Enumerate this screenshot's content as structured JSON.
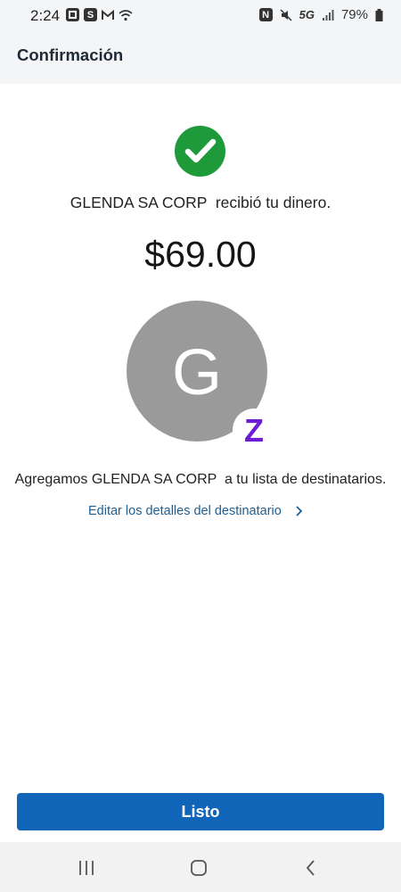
{
  "status_bar": {
    "time": "2:24",
    "network": "5G",
    "battery": "79%",
    "icons_left": [
      "chase-icon",
      "s-app-icon",
      "gmail-icon",
      "wifi-icon"
    ],
    "icons_right": [
      "nfc-icon",
      "mute-icon",
      "signal-icon",
      "battery-icon"
    ]
  },
  "header": {
    "title": "Confirmación"
  },
  "confirmation": {
    "received_message": "GLENDA SA CORP  recibió tu dinero.",
    "amount": "$69.00"
  },
  "recipient": {
    "initial": "G",
    "zelle_mark": "Z",
    "added_message": "Agregamos GLENDA SA CORP  a tu lista de destinatarios.",
    "edit_link": "Editar los detalles del destinatario"
  },
  "actions": {
    "done_label": "Listo"
  },
  "colors": {
    "success": "#1f9a3b",
    "primary": "#1165b8",
    "link": "#1f5f94",
    "zelle": "#6d1ed4",
    "avatar": "#9a9a9a"
  }
}
